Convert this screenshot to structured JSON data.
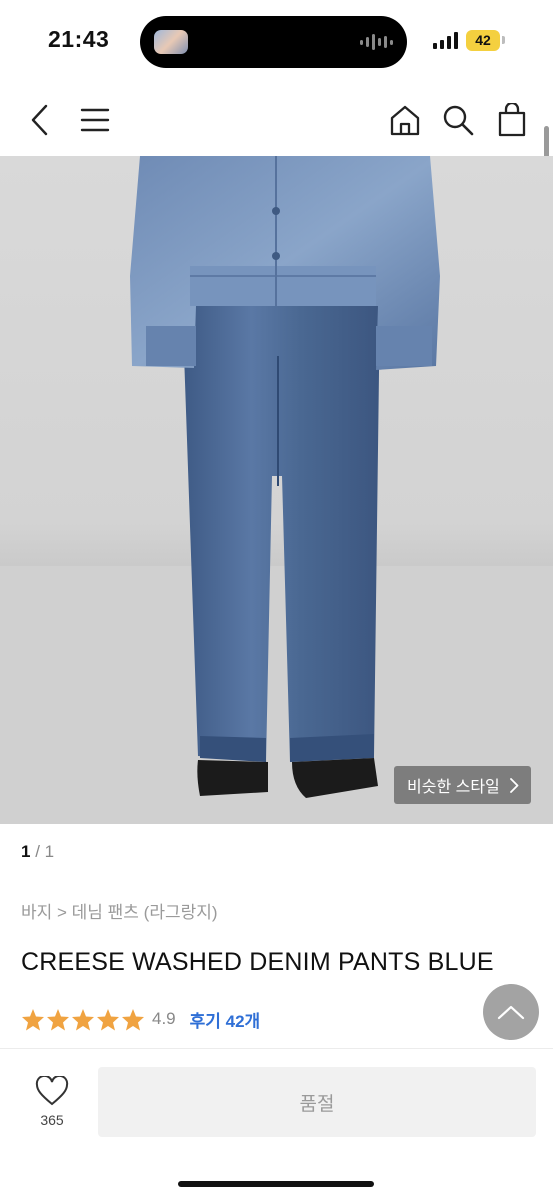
{
  "status_bar": {
    "time": "21:43",
    "battery": "42"
  },
  "header": {
    "icons": [
      "back-icon",
      "menu-icon",
      "home-icon",
      "search-icon",
      "shopping-bag-icon"
    ]
  },
  "gallery": {
    "current": "1",
    "separator": " / ",
    "total": "1",
    "similar_style_label": "비슷한 스타일"
  },
  "product": {
    "breadcrumb": "바지 > 데님 팬츠 (라그랑지)",
    "title": "CREESE WASHED DENIM PANTS BLUE",
    "rating": "4.9",
    "stars": 5,
    "review_label": "후기 42개"
  },
  "bottom_bar": {
    "wish_count": "365",
    "sold_out_label": "품절"
  },
  "colors": {
    "star": "#f0a341",
    "review_link": "#2f6fd6",
    "sold_out_bg": "#f1f1f1",
    "denim": "#4a6690"
  }
}
